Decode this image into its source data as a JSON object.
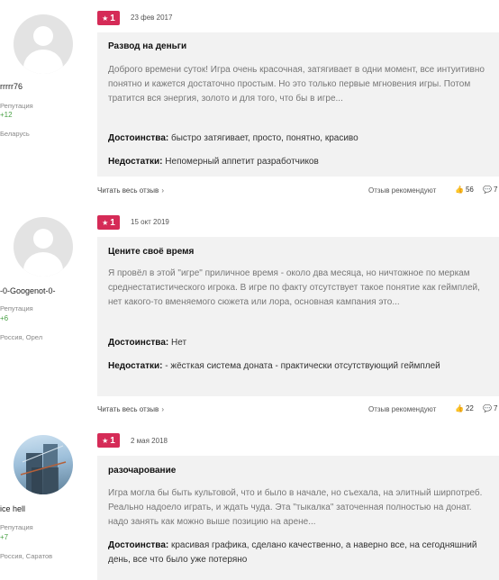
{
  "reviews": [
    {
      "user": "rrrrr76",
      "rep_label": "Репутация",
      "rep_value": "+12",
      "location": "Беларусь",
      "rating": "1",
      "date": "23 фев 2017",
      "title": "Развод на деньги",
      "body": "Доброго времени суток! Игра очень красочная, затягивает в одни момент, все интуитивно понятно и кажется достаточно простым. Но это только первые мгновения игры. Потом тратится вся энергия, золото и для того, что бы в игре...",
      "pros_label": "Достоинства:",
      "pros": "быстро затягивает, просто, понятно, красиво",
      "cons_label": "Недостатки:",
      "cons": "Непомерный аппетит разработчиков",
      "read_more": "Читать весь отзыв",
      "recommend": "Отзыв рекомендуют",
      "likes": "56",
      "comments": "7"
    },
    {
      "user": "-0-Googenot-0-",
      "rep_label": "Репутация",
      "rep_value": "+6",
      "location": "Россия, Орел",
      "rating": "1",
      "date": "15 окт 2019",
      "title": "Цените своё время",
      "body": "Я провёл в этой \"игре\" приличное время - около два месяца, но ничтожное по меркам среднестатистического игрока. В игре по факту отсутствует такое понятие как геймплей, нет какого-то вменяемого сюжета или лора, основная кампания это...",
      "pros_label": "Достоинства:",
      "pros": "Нет",
      "cons_label": "Недостатки:",
      "cons": "- жёсткая система доната - практически отсутствующий геймплей",
      "read_more": "Читать весь отзыв",
      "recommend": "Отзыв рекомендуют",
      "likes": "22",
      "comments": "7"
    },
    {
      "user": "ice hell",
      "rep_label": "Репутация",
      "rep_value": "+7",
      "location": "Россия, Саратов",
      "rating": "1",
      "date": "2 мая 2018",
      "title": "разочарование",
      "body": "Игра могла бы быть культовой, что и было в начале, но съехала, на элитный ширпотреб. Реально надоело играть, и ждать чуда. Эта \"тыкалка\" заточенная полностью на донат. надо занять как можно выше позицию на арене...",
      "pros_label": "Достоинства:",
      "pros": "красивая графика, сделано качественно, а наверно все, на сегодняшний день, все что было уже потеряно"
    }
  ]
}
